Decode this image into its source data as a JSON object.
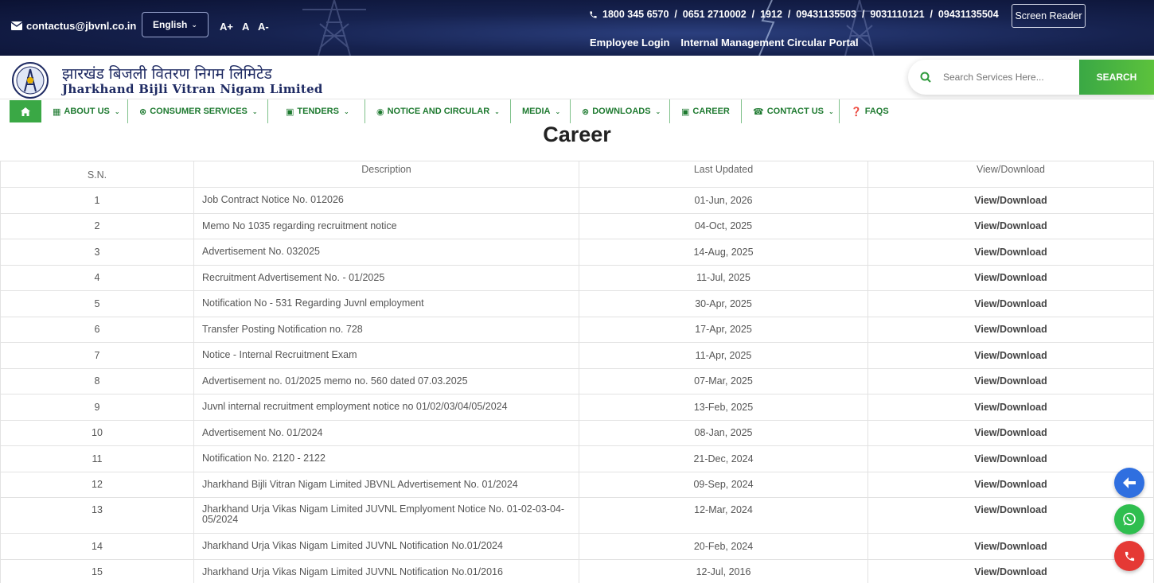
{
  "topbar": {
    "email": "contactus@jbvnl.co.in",
    "language": "English",
    "font_increase": "A+",
    "font_normal": "A",
    "font_decrease": "A-",
    "phones": "1800 345 6570  /  0651 2710002  /  1912  /  09431135503  /  9031110121  /  09431135504",
    "screen_reader": "Screen Reader",
    "employee_login": "Employee Login",
    "circular_portal": "Internal Management Circular Portal"
  },
  "brand": {
    "name_hindi": "झारखंड बिजली वितरण निगम लिमिटेड",
    "name_english": "Jharkhand Bijli Vitran Nigam Limited"
  },
  "search": {
    "placeholder": "Search Services Here...",
    "button": "SEARCH"
  },
  "nav": {
    "about": "ABOUT US",
    "consumer": "CONSUMER SERVICES",
    "tenders": "TENDERS",
    "notice": "NOTICE AND CIRCULAR",
    "media": "MEDIA",
    "downloads": "DOWNLOADS",
    "career": "CAREER",
    "contact": "CONTACT US",
    "faqs": "FAQS"
  },
  "page": {
    "title": "Career"
  },
  "table": {
    "headers": [
      "S.N.",
      "Description",
      "Last Updated",
      "View/Download"
    ],
    "rows": [
      {
        "sn": "1",
        "desc": "Job Contract Notice No. 012026",
        "date": "01-Jun, 2026",
        "action": "View/Download"
      },
      {
        "sn": "2",
        "desc": "Memo No 1035 regarding recruitment notice",
        "date": "04-Oct, 2025",
        "action": "View/Download"
      },
      {
        "sn": "3",
        "desc": "Advertisement No. 032025",
        "date": "14-Aug, 2025",
        "action": "View/Download"
      },
      {
        "sn": "4",
        "desc": "Recruitment Advertisement No. - 01/2025",
        "date": "11-Jul, 2025",
        "action": "View/Download"
      },
      {
        "sn": "5",
        "desc": "Notification No - 531 Regarding Juvnl employment",
        "date": "30-Apr, 2025",
        "action": "View/Download"
      },
      {
        "sn": "6",
        "desc": "Transfer Posting Notification no. 728",
        "date": "17-Apr, 2025",
        "action": "View/Download"
      },
      {
        "sn": "7",
        "desc": "Notice - Internal Recruitment Exam",
        "date": "11-Apr, 2025",
        "action": "View/Download"
      },
      {
        "sn": "8",
        "desc": "Advertisement no. 01/2025 memo no. 560 dated 07.03.2025",
        "date": "07-Mar, 2025",
        "action": "View/Download"
      },
      {
        "sn": "9",
        "desc": "Juvnl internal recruitment employment notice no 01/02/03/04/05/2024",
        "date": "13-Feb, 2025",
        "action": "View/Download"
      },
      {
        "sn": "10",
        "desc": "Advertisement No. 01/2024",
        "date": "08-Jan, 2025",
        "action": "View/Download"
      },
      {
        "sn": "11",
        "desc": "Notification No. 2120 - 2122",
        "date": "21-Dec, 2024",
        "action": "View/Download"
      },
      {
        "sn": "12",
        "desc": "Jharkhand Bijli Vitran Nigam Limited JBVNL Advertisement No. 01/2024",
        "date": "09-Sep, 2024",
        "action": "View/Download"
      },
      {
        "sn": "13",
        "desc": "Jharkhand Urja Vikas Nigam Limited JUVNL Emplyoment Notice No. 01-02-03-04-05/2024",
        "date": "12-Mar, 2024",
        "action": "View/Download"
      },
      {
        "sn": "14",
        "desc": "Jharkhand Urja Vikas Nigam Limited JUVNL Notification No.01/2024",
        "date": "20-Feb, 2024",
        "action": "View/Download"
      },
      {
        "sn": "15",
        "desc": "Jharkhand Urja Vikas Nigam Limited JUVNL Notification No.01/2016",
        "date": "12-Jul, 2016",
        "action": "View/Download"
      }
    ]
  },
  "colors": {
    "nav_green": "#1e7a30",
    "accent_green": "#3aa845",
    "back_blue": "#2f6fe0",
    "whatsapp_green": "#2fbe4f",
    "call_red": "#e53935"
  }
}
